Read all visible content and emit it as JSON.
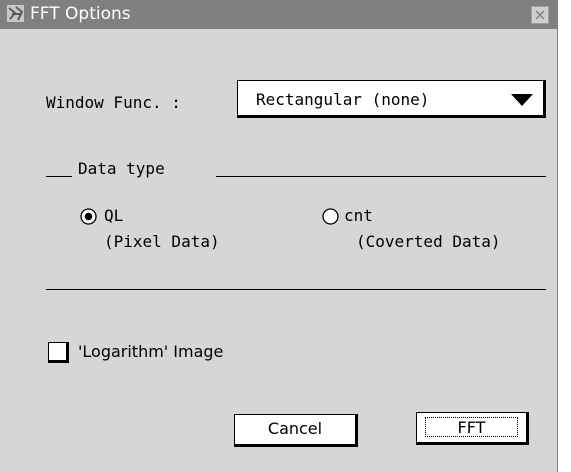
{
  "window": {
    "title": "FFT Options",
    "icons": {
      "app": "app-icon",
      "close": "close-icon"
    }
  },
  "window_func": {
    "label": "Window Func. :",
    "selected": "Rectangular (none)"
  },
  "data_type": {
    "title": "Data type",
    "options": [
      {
        "label": "QL",
        "sub": "(Pixel Data)",
        "selected": true
      },
      {
        "label": "cnt",
        "sub": "(Coverted Data)",
        "selected": false
      }
    ]
  },
  "log_image": {
    "label": "'Logarithm' Image",
    "checked": false
  },
  "buttons": {
    "cancel": "Cancel",
    "fft": "FFT"
  }
}
